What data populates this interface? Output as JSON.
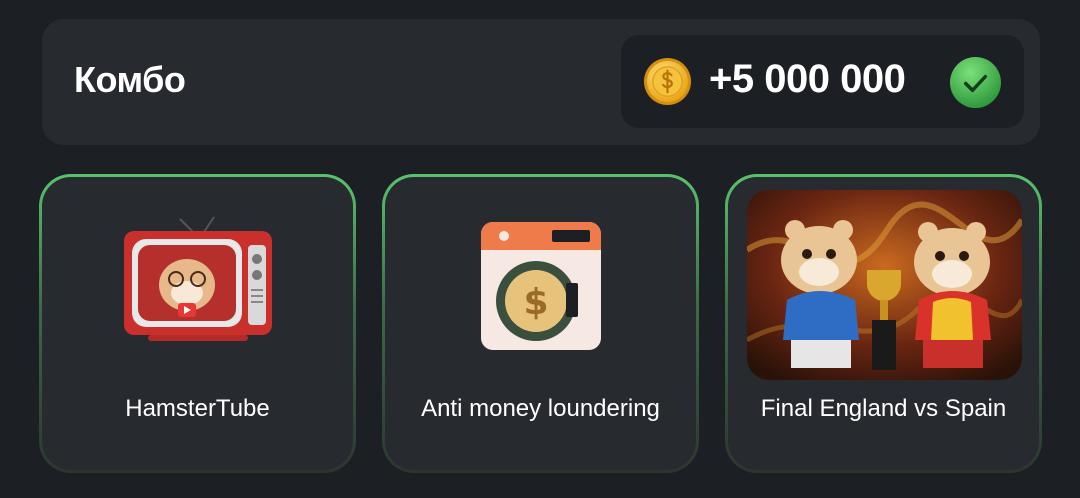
{
  "header": {
    "title": "Комбо",
    "reward": "+5 000 000",
    "coin_icon": "coin-icon",
    "status_icon": "check-icon"
  },
  "cards": [
    {
      "label": "HamsterTube",
      "icon": "hamster-tv-icon"
    },
    {
      "label": "Anti money loundering",
      "icon": "washing-machine-coin-icon"
    },
    {
      "label": "Final England vs Spain",
      "icon": "hamsters-trophy-image"
    }
  ],
  "colors": {
    "background": "#1c1f24",
    "panel": "#272a2f",
    "accent_green": "#58c46a",
    "coin_gold": "#f3c43a"
  }
}
